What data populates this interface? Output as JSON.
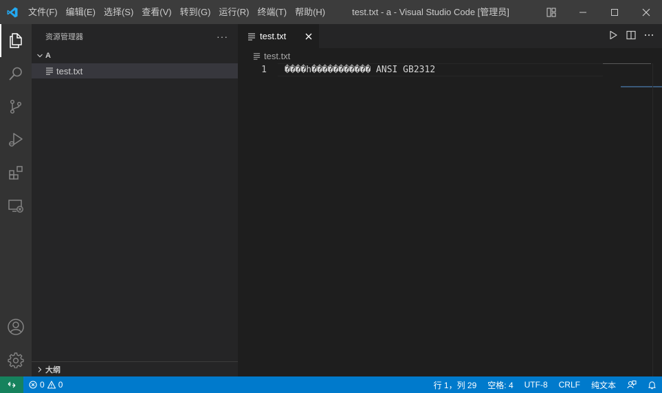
{
  "titlebar": {
    "menu": [
      "文件(F)",
      "编辑(E)",
      "选择(S)",
      "查看(V)",
      "转到(G)",
      "运行(R)",
      "终端(T)",
      "帮助(H)"
    ],
    "title": "test.txt - a - Visual Studio Code [管理员]"
  },
  "sidebar": {
    "title": "资源管理器",
    "more": "···",
    "folder": "A",
    "file": "test.txt",
    "outline": "大纲"
  },
  "editor": {
    "tab_label": "test.txt",
    "breadcrumb": "test.txt",
    "lines": [
      {
        "number": "1",
        "text": "����h����������� ANSI GB2312"
      }
    ]
  },
  "statusbar": {
    "errors": "0",
    "warnings": "0",
    "position": "行 1，列 29",
    "indent": "空格: 4",
    "encoding": "UTF-8",
    "eol": "CRLF",
    "language": "纯文本"
  },
  "colors": {
    "statusbar": "#007acc",
    "remote": "#16825d",
    "titlebar": "#3c3c3c",
    "activitybar": "#333333",
    "sidebar": "#252526",
    "editor": "#1e1e1e",
    "vscode_blue": "#23a9f2"
  }
}
